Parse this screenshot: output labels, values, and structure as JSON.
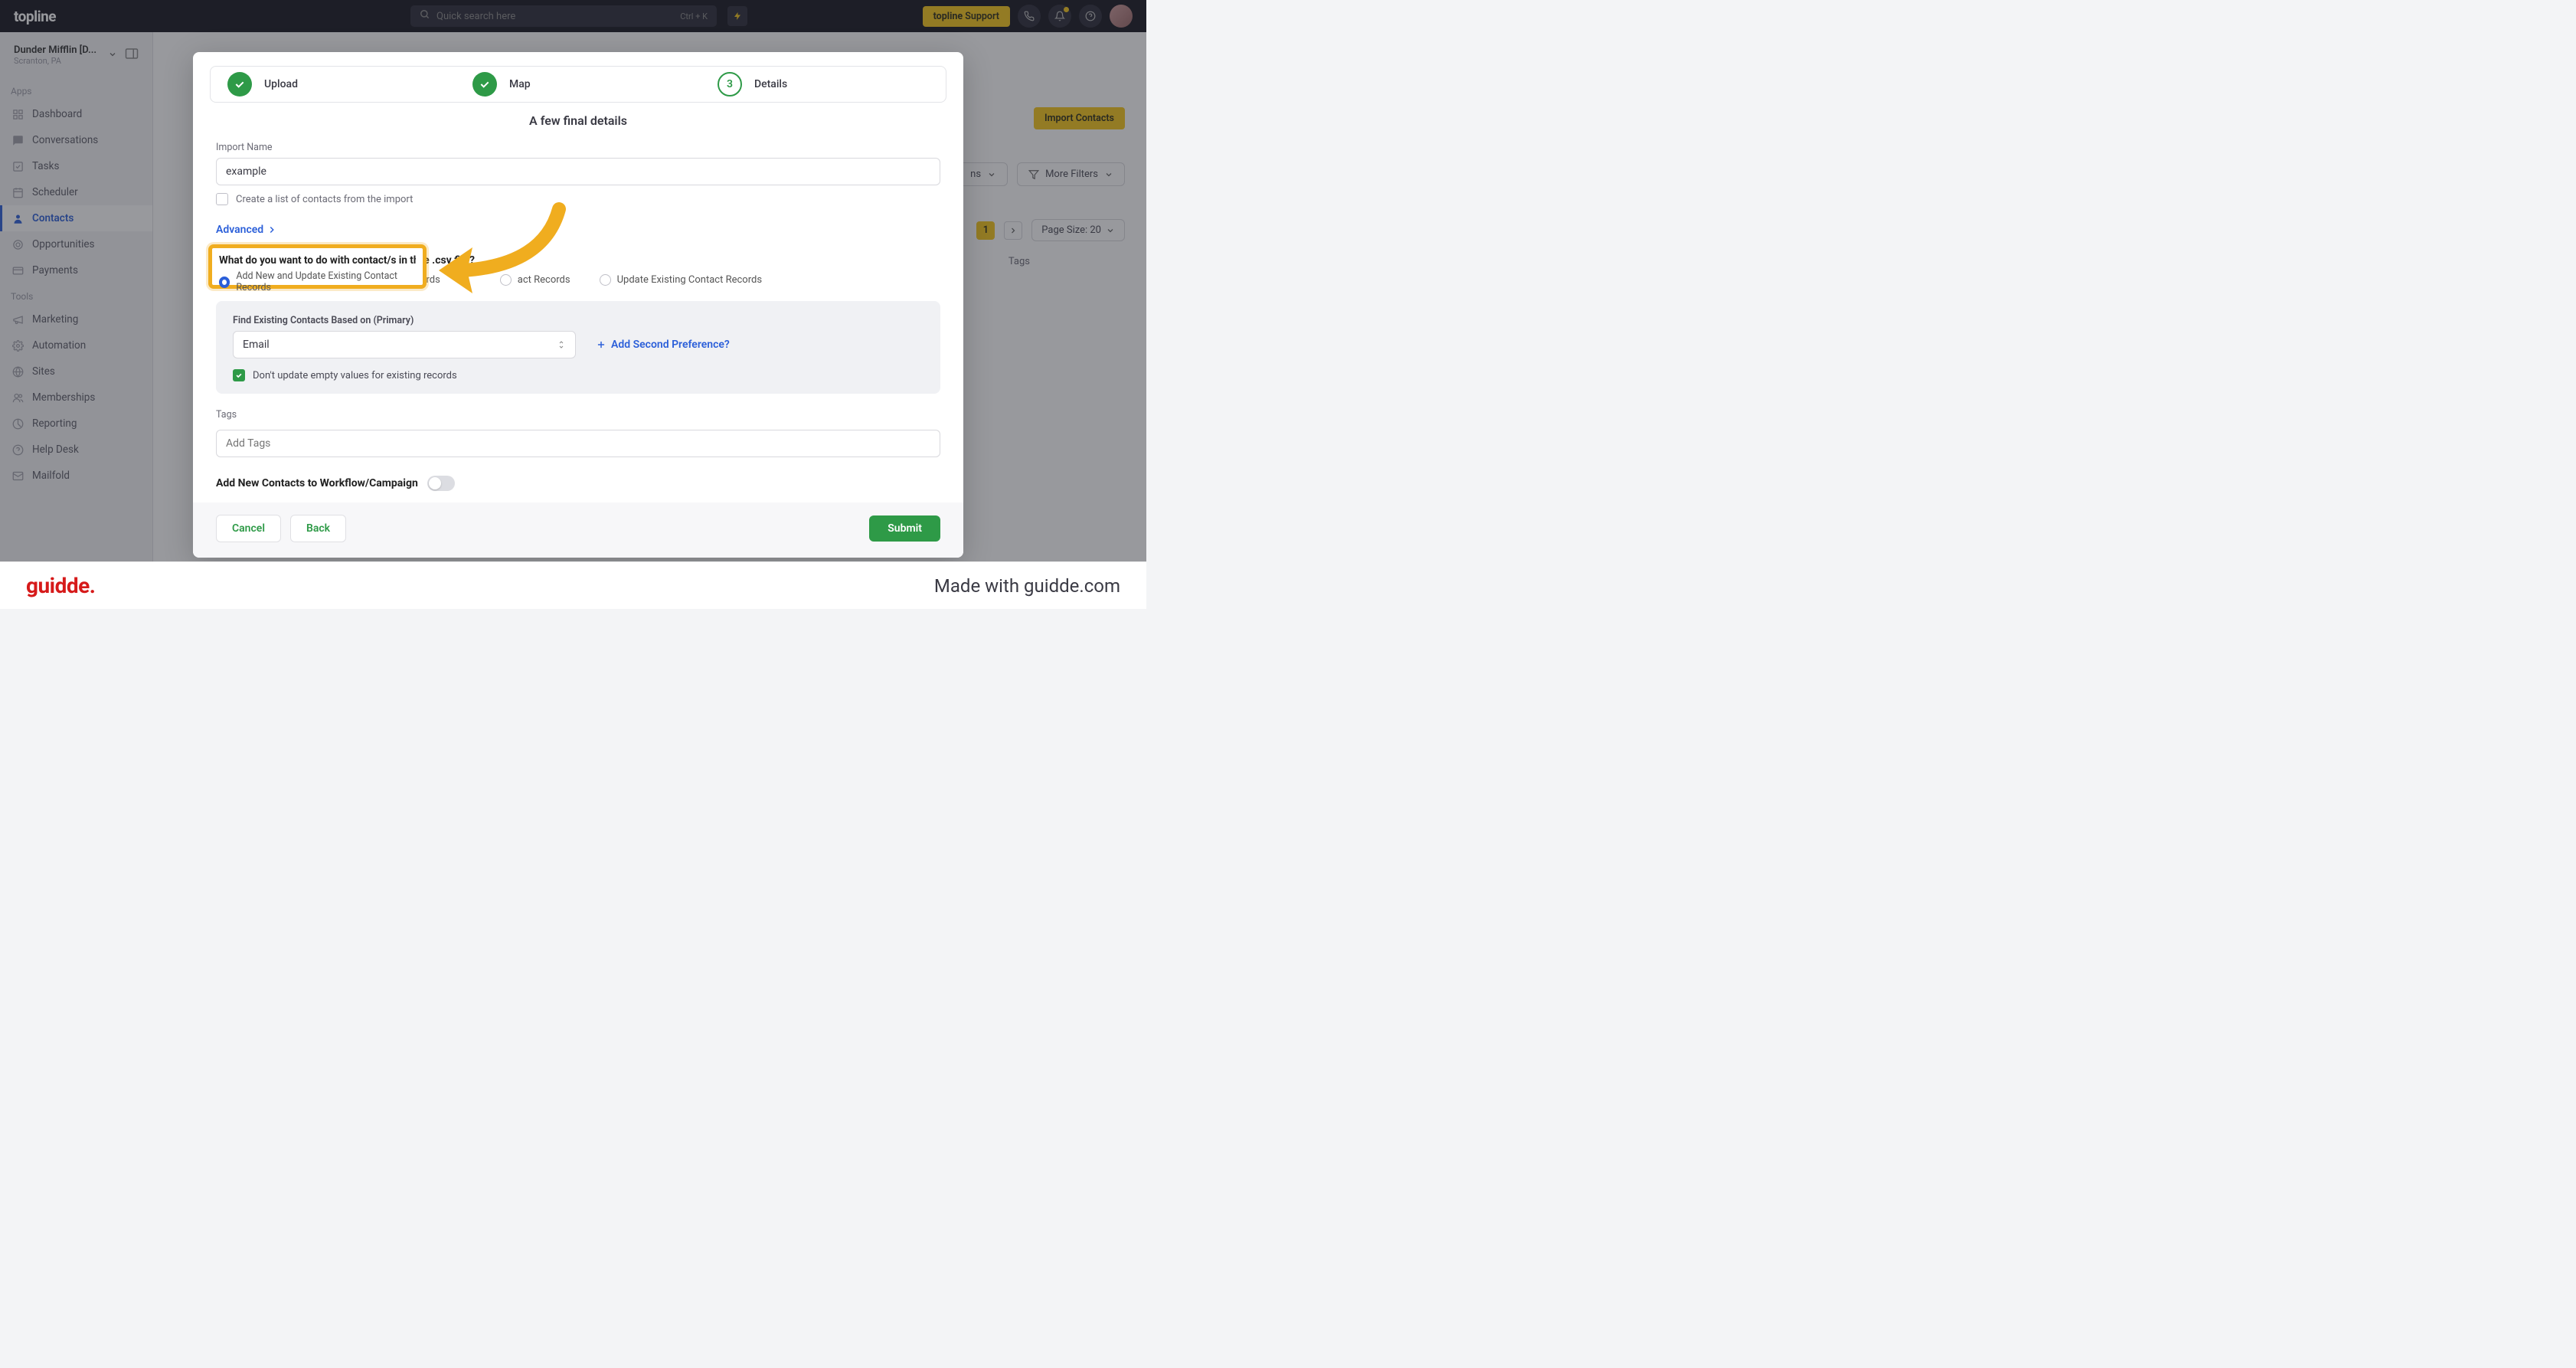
{
  "header": {
    "logo": "topline",
    "search_placeholder": "Quick search here",
    "shortcut": "Ctrl + K",
    "support_prefix": "topline",
    "support_label": "Support"
  },
  "location": {
    "name": "Dunder Mifflin [D...",
    "sub": "Scranton, PA"
  },
  "sidebar": {
    "section_apps": "Apps",
    "section_tools": "Tools",
    "apps": [
      {
        "label": "Dashboard",
        "icon": "grid"
      },
      {
        "label": "Conversations",
        "icon": "chat"
      },
      {
        "label": "Tasks",
        "icon": "check"
      },
      {
        "label": "Scheduler",
        "icon": "calendar"
      },
      {
        "label": "Contacts",
        "icon": "user",
        "active": true
      },
      {
        "label": "Opportunities",
        "icon": "crosshair"
      },
      {
        "label": "Payments",
        "icon": "card"
      }
    ],
    "tools": [
      {
        "label": "Marketing",
        "icon": "megaphone"
      },
      {
        "label": "Automation",
        "icon": "gear"
      },
      {
        "label": "Sites",
        "icon": "globe"
      },
      {
        "label": "Memberships",
        "icon": "users"
      },
      {
        "label": "Reporting",
        "icon": "chart"
      },
      {
        "label": "Help Desk",
        "icon": "help"
      },
      {
        "label": "Mailfold",
        "icon": "mail"
      }
    ]
  },
  "toolbar": {
    "import_contacts": "Import Contacts",
    "columns_dropdown": "ns",
    "more_filters": "More Filters",
    "page_number": "1",
    "page_size_label": "Page Size: 20",
    "tags_col": "Tags"
  },
  "modal": {
    "steps": {
      "upload": "Upload",
      "map": "Map",
      "details_num": "3",
      "details": "Details"
    },
    "title": "A few final details",
    "import_name_label": "Import Name",
    "import_name_value": "example",
    "create_list_label": "Create a list of contacts from the import",
    "advanced_label": "Advanced",
    "question": "What do you want to do with contact/s in the .csv file?",
    "radio1": "Add New and Update Existing Contact Records",
    "radio2_tail": "act Records",
    "radio3": "Update Existing Contact Records",
    "find_label": "Find Existing Contacts Based on (Primary)",
    "find_value": "Email",
    "add_pref": "Add Second Preference?",
    "dont_update": "Don't update empty values for existing records",
    "tags_label": "Tags",
    "tags_placeholder": "Add Tags",
    "workflow_label": "Add New Contacts to Workflow/Campaign",
    "cancel": "Cancel",
    "back": "Back",
    "submit": "Submit"
  },
  "highlight": {
    "q_partial": "What do you want to do with contact/s in the .csv f",
    "opt": "Add New and Update Existing Contact Records"
  },
  "footer": {
    "logo": "guidde.",
    "made": "Made with guidde.com"
  }
}
